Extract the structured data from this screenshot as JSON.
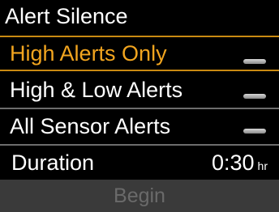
{
  "title": "Alert Silence",
  "options": [
    {
      "label": "High Alerts Only",
      "selected": true,
      "toggle": "off"
    },
    {
      "label": "High & Low Alerts",
      "selected": false,
      "toggle": "off"
    },
    {
      "label": "All Sensor Alerts",
      "selected": false,
      "toggle": "off"
    }
  ],
  "duration": {
    "label": "Duration",
    "value": "0:30",
    "unit": "hr"
  },
  "begin_label": "Begin",
  "colors": {
    "accent": "#f2a51f",
    "background": "#000000",
    "text": "#ffffff",
    "disabled_text": "#6a6a6a",
    "disabled_bg": "#3a3a3a"
  }
}
